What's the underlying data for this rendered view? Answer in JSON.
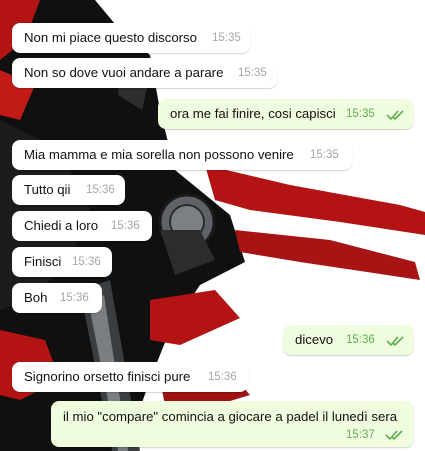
{
  "chat": {
    "messages": [
      {
        "direction": "in",
        "text": "Non mi piace questo discorso",
        "time": "15:35"
      },
      {
        "direction": "in",
        "text": "Non so dove vuoi andare a parare",
        "time": "15:35"
      },
      {
        "direction": "out",
        "text": "ora me fai finire, cosi capisci",
        "time": "15:35",
        "read": true
      },
      {
        "direction": "in",
        "text": "Mia mamma e mia sorella non possono venire",
        "time": "15:35"
      },
      {
        "direction": "in",
        "text": "Tutto qii",
        "time": "15:36"
      },
      {
        "direction": "in",
        "text": "Chiedi a loro",
        "time": "15:36"
      },
      {
        "direction": "in",
        "text": "Finisci",
        "time": "15:36"
      },
      {
        "direction": "in",
        "text": "Boh",
        "time": "15:36"
      },
      {
        "direction": "out",
        "text": "dicevo",
        "time": "15:36",
        "read": true
      },
      {
        "direction": "in",
        "text": "Signorino orsetto finisci pure",
        "time": "15:36"
      },
      {
        "direction": "out",
        "text": "il mio \"compare\" comincia a giocare a padel il lunedì sera",
        "time": "15:37",
        "read": true
      }
    ]
  },
  "colors": {
    "incoming_bubble": "#ffffff",
    "outgoing_bubble": "#effdde",
    "read_ticks": "#5fae53",
    "timestamp": "#a2a7ab",
    "wallpaper_dark": "#101010",
    "wallpaper_red": "#b31313",
    "wallpaper_metal": "#6b6f73"
  },
  "icons": {
    "read_receipt": "double-check-icon"
  }
}
